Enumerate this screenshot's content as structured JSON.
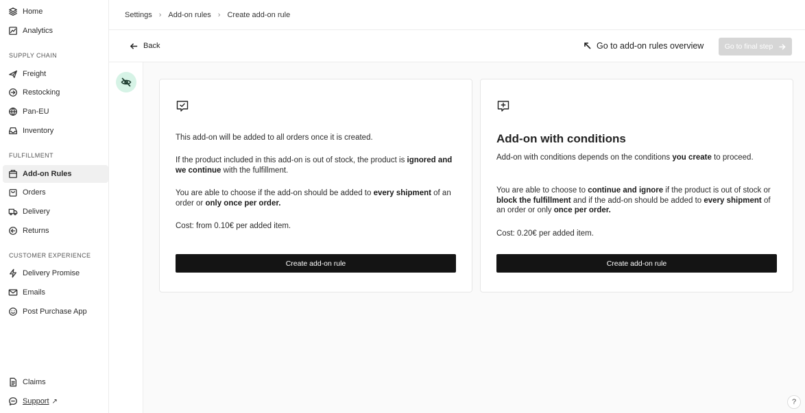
{
  "sidebar": {
    "top_items": [
      {
        "label": "Home",
        "icon": "layers-icon"
      },
      {
        "label": "Analytics",
        "icon": "chart-icon"
      }
    ],
    "sections": [
      {
        "label": "SUPPLY CHAIN",
        "items": [
          {
            "label": "Freight",
            "icon": "plane-icon"
          },
          {
            "label": "Restocking",
            "icon": "arrow-circle-icon"
          },
          {
            "label": "Pan-EU",
            "icon": "globe-icon"
          },
          {
            "label": "Inventory",
            "icon": "inbox-icon"
          }
        ]
      },
      {
        "label": "FULFILLMENT",
        "items": [
          {
            "label": "Add-on Rules",
            "icon": "box-plus-icon"
          },
          {
            "label": "Orders",
            "icon": "bag-icon"
          },
          {
            "label": "Delivery",
            "icon": "truck-icon"
          },
          {
            "label": "Returns",
            "icon": "return-icon"
          }
        ]
      },
      {
        "label": "CUSTOMER EXPERIENCE",
        "items": [
          {
            "label": "Delivery Promise",
            "icon": "bolt-icon"
          },
          {
            "label": "Emails",
            "icon": "mail-icon"
          },
          {
            "label": "Post Purchase App",
            "icon": "smile-icon"
          }
        ]
      }
    ],
    "bottom_items": [
      {
        "label": "Claims",
        "icon": "document-icon"
      },
      {
        "label": "Support",
        "icon": "chat-icon"
      }
    ],
    "active": "Add-on Rules"
  },
  "breadcrumb": {
    "items": [
      "Settings",
      "Add-on rules",
      "Create add-on rule"
    ]
  },
  "action_bar": {
    "back_label": "Back",
    "overview_label": "Go to add-on rules overview",
    "final_label": "Go to final step"
  },
  "cards": [
    {
      "title": "",
      "paragraphs": [
        [
          {
            "t": "This add-on will be added to all orders once it is created."
          }
        ],
        [
          {
            "t": "If the product included in this add-on is out of stock, the product is "
          },
          {
            "t": "ignored and we continue",
            "b": true
          },
          {
            "t": " with the fulfillment."
          }
        ],
        [
          {
            "t": "You are able to choose if the add-on should be added to "
          },
          {
            "t": "every shipment",
            "b": true
          },
          {
            "t": " of an order or "
          },
          {
            "t": "only once per order.",
            "b": true
          }
        ],
        [
          {
            "t": "Cost: from 0.10€ per added item."
          }
        ]
      ],
      "button_label": "Create add-on rule"
    },
    {
      "title": "Add-on with conditions",
      "paragraphs": [
        [
          {
            "t": "Add-on with conditions depends on the conditions "
          },
          {
            "t": "you create",
            "b": true
          },
          {
            "t": " to proceed."
          }
        ],
        [
          {
            "t": "You are able to choose to "
          },
          {
            "t": "continue and ignore",
            "b": true
          },
          {
            "t": " if the product is out of stock or "
          },
          {
            "t": "block the fulfillment",
            "b": true
          },
          {
            "t": " and if the add-on should be added to "
          },
          {
            "t": "every shipment",
            "b": true
          },
          {
            "t": " of an order or only "
          },
          {
            "t": "once per order.",
            "b": true
          }
        ],
        [
          {
            "t": "Cost: 0.20€ per added item."
          }
        ]
      ],
      "button_label": "Create add-on rule"
    }
  ],
  "help_label": "?"
}
